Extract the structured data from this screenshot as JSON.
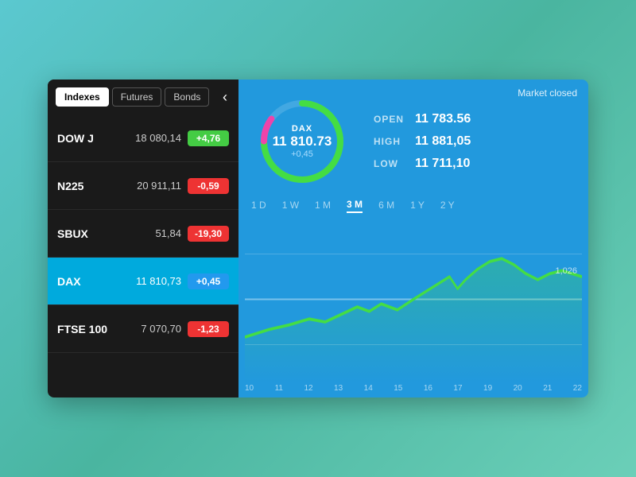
{
  "tabs": [
    {
      "label": "Indexes",
      "active": true
    },
    {
      "label": "Futures",
      "active": false
    },
    {
      "label": "Bonds",
      "active": false
    }
  ],
  "stocks": [
    {
      "name": "DOW J",
      "value": "18 080,14",
      "change": "+4,76",
      "type": "green",
      "active": false
    },
    {
      "name": "N225",
      "value": "20 911,11",
      "change": "-0,59",
      "type": "red",
      "active": false
    },
    {
      "name": "SBUX",
      "value": "51,84",
      "change": "-19,30",
      "type": "red",
      "active": false
    },
    {
      "name": "DAX",
      "value": "11 810,73",
      "change": "+0,45",
      "type": "blue",
      "active": true
    },
    {
      "name": "FTSE 100",
      "value": "7 070,70",
      "change": "-1,23",
      "type": "red",
      "active": false
    }
  ],
  "detail": {
    "ticker": "DAX",
    "price": "11 810.73",
    "change": "+0,45",
    "market_status": "Market closed",
    "open_label": "OPEN",
    "open_value": "11 783.56",
    "high_label": "HIGH",
    "high_value": "11 881,05",
    "low_label": "LOW",
    "low_value": "11 711,10"
  },
  "time_ranges": [
    {
      "label": "1 D",
      "active": false
    },
    {
      "label": "1 W",
      "active": false
    },
    {
      "label": "1 M",
      "active": false
    },
    {
      "label": "3 M",
      "active": true
    },
    {
      "label": "6 M",
      "active": false
    },
    {
      "label": "1 Y",
      "active": false
    },
    {
      "label": "2 Y",
      "active": false
    }
  ],
  "chart": {
    "y_label": "1,026",
    "x_labels": [
      "10",
      "11",
      "12",
      "13",
      "14",
      "15",
      "16",
      "17",
      "19",
      "20",
      "21",
      "22"
    ]
  },
  "chevron": "‹"
}
